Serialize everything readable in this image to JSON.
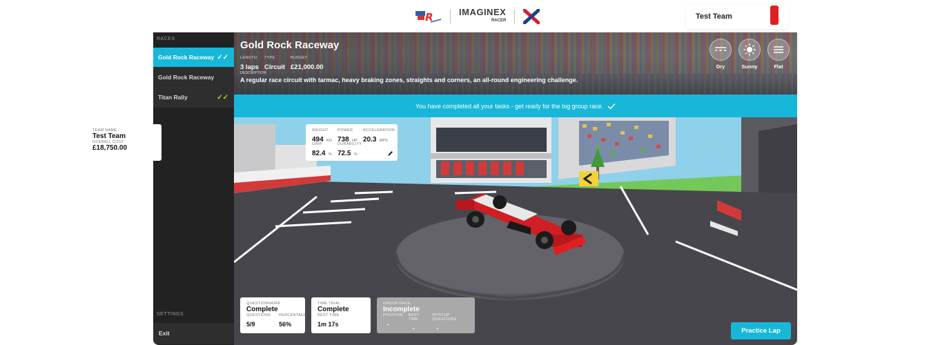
{
  "header": {
    "logo_brand": "IMAGINEX",
    "logo_brand_sub": "RACER",
    "team_name": "Test Team",
    "team_color": "#e02020"
  },
  "sidebar": {
    "races_heading": "RACES",
    "items": [
      {
        "label": "Gold Rock Raceway",
        "status": "✓✓",
        "active": true
      },
      {
        "label": "Gold Rock Raceway",
        "status": ""
      },
      {
        "label": "Titan Rally",
        "status": "✓✓"
      }
    ],
    "settings_heading": "SETTINGS",
    "exit_label": "Exit"
  },
  "race": {
    "title": "Gold Rock Raceway",
    "length_label": "LENGTH",
    "length_value": "3 laps",
    "type_label": "TYPE",
    "type_value": "Circuit",
    "budget_label": "BUDGET",
    "budget_value": "£21,000.00",
    "description_label": "DESCRIPTION",
    "description": "A regular race circuit with tarmac, heavy braking zones, straights and corners, an all-round engineering challenge.",
    "conditions": [
      {
        "label": "Dry",
        "icon": "road-dry-icon"
      },
      {
        "label": "Sunny",
        "icon": "sun-icon"
      },
      {
        "label": "Flat",
        "icon": "flat-terrain-icon"
      }
    ]
  },
  "notice": {
    "text": "You have completed all your tasks - get ready for the big group race.",
    "icon": "check-icon"
  },
  "team_card": {
    "name_label": "TEAM NAME",
    "name": "Test Team",
    "cost_label": "OVERALL COST",
    "cost": "£18,750.00"
  },
  "stats": {
    "weight_label": "WEIGHT",
    "weight": "494",
    "weight_unit": "KG",
    "power_label": "POWER",
    "power": "738",
    "power_unit": "HP",
    "accel_label": "ACCELERATION",
    "accel": "20.3",
    "accel_unit": "MPS",
    "grip_label": "GRIP",
    "grip": "82.4",
    "grip_unit": "%",
    "durability_label": "DURABILITY",
    "durability": "72.5",
    "durability_unit": "%",
    "edit_icon": "pencil-icon"
  },
  "results": {
    "questionnaire": {
      "label": "QUESTIONNAIRE",
      "status": "Complete",
      "q_label": "QUESTIONS",
      "q_value": "5/9",
      "p_label": "PERCENTAGE",
      "p_value": "56%"
    },
    "time_trial": {
      "label": "TIME TRIAL",
      "status": "Complete",
      "bt_label": "BEST TIME",
      "bt_value": "1m 17s"
    },
    "group_race": {
      "label": "GROUP RACE",
      "status": "Incomplete",
      "pos_label": "POSITION",
      "pos_value": "-",
      "bt_label": "BEST TIME",
      "bt_value": "-",
      "pit_label": "PITSTOP QUESTIONS",
      "pit_value": "-"
    }
  },
  "actions": {
    "practice_label": "Practice Lap"
  },
  "colors": {
    "accent": "#17b7d9",
    "sidebar": "#222222",
    "car": "#e02020"
  }
}
